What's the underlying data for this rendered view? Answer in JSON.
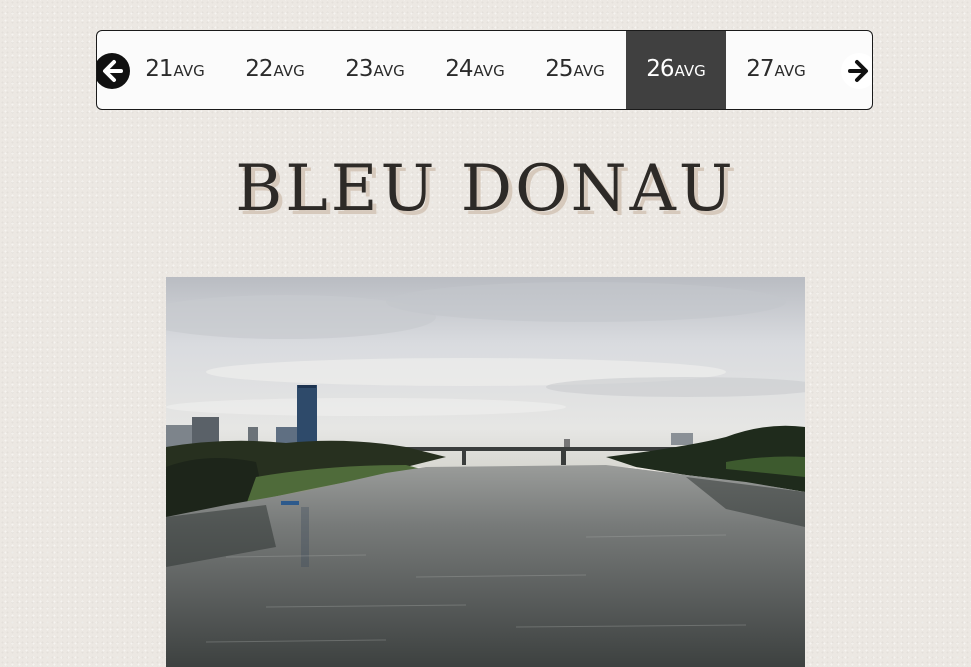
{
  "nav": {
    "prev_label": "←",
    "next_label": "→",
    "days": [
      {
        "num": "21",
        "month": "avg"
      },
      {
        "num": "22",
        "month": "avg"
      },
      {
        "num": "23",
        "month": "avg"
      },
      {
        "num": "24",
        "month": "avg"
      },
      {
        "num": "25",
        "month": "avg"
      },
      {
        "num": "26",
        "month": "avg"
      },
      {
        "num": "27",
        "month": "avg"
      }
    ],
    "active_index": 5
  },
  "post": {
    "title": "Bleu Donau"
  },
  "colors": {
    "active_bg": "#404040",
    "page_bg": "#ece8e3",
    "title_shadow": "#d6c9bc"
  }
}
